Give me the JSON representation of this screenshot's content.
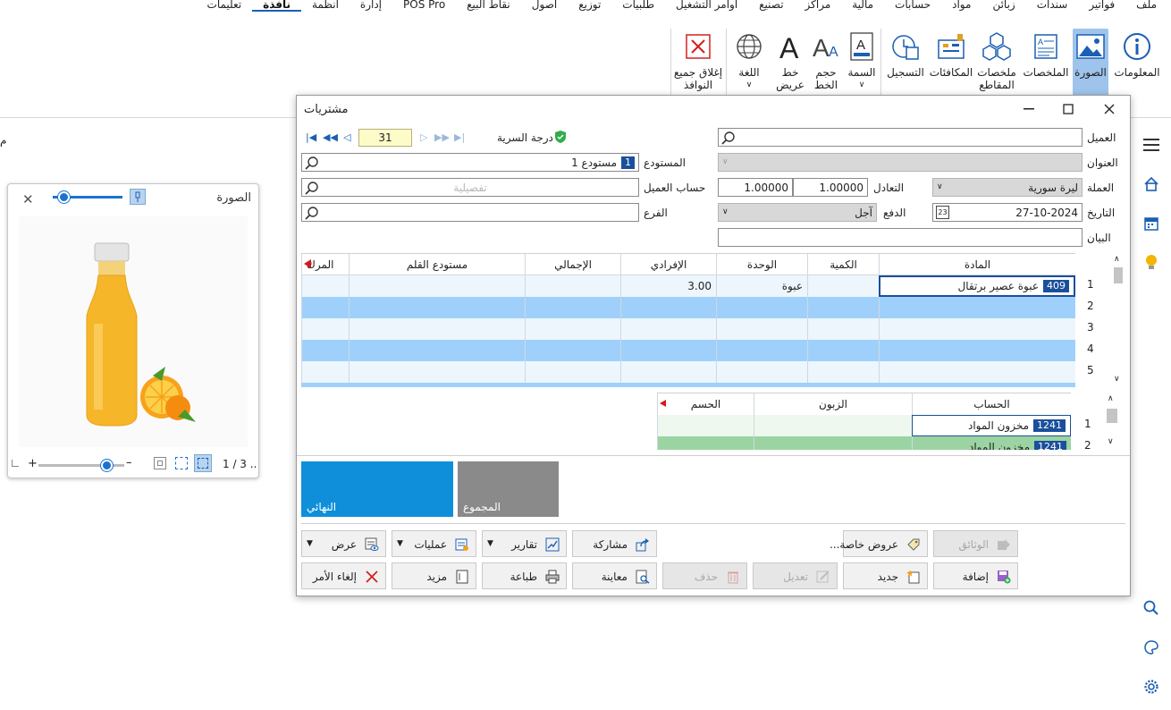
{
  "menu": [
    "ملف",
    "فواتير",
    "سندات",
    "زبائن",
    "مواد",
    "حسابات",
    "مالية",
    "مراكز",
    "تصنيع",
    "أوامر التشغيل",
    "طلبيات",
    "توزيع",
    "أصول",
    "نقاط البيع",
    "POS Pro",
    "إدارة",
    "أنظمة",
    "نافذة",
    "تعليمات"
  ],
  "menu_active": "نافذة",
  "ribbon": {
    "info": "المعلومات",
    "image": "الصورة",
    "summaries": "الملخصات",
    "segment_summaries": "ملخصات\nالمقاطع",
    "rewards": "المكافئات",
    "registration": "التسجيل",
    "theme": "السمة",
    "font_size": "حجم\nالخط",
    "bold_font": "خط\nعريض",
    "language": "اللغة",
    "close_all": "إغلاق جميع\nالنوافذ"
  },
  "image_panel": {
    "title": "الصورة",
    "pager": "1 / 3 .."
  },
  "dialog": {
    "title": "مشتريات",
    "customer_label": "العميل",
    "address_label": "العنوان",
    "currency_label": "العملة",
    "currency_value": "ليرة سورية",
    "exchange_label": "التعادل",
    "exchange_value_1": "1.00000",
    "exchange_value_2": "1.00000",
    "date_label": "التاريخ",
    "date_value": "27-10-2024",
    "payment_label": "الدفع",
    "payment_value": "آجل",
    "statement_label": "البيان",
    "secrecy_label": "درجة السرية",
    "record_number": "31",
    "warehouse_label": "المستودع",
    "warehouse_code": "1",
    "warehouse_value": "مستودع 1",
    "customer_account_label": "حساب العميل",
    "customer_account_placeholder": "تفصيلية",
    "branch_label": "الفرع"
  },
  "items_grid": {
    "headers": [
      "المادة",
      "الكمية",
      "الوحدة",
      "الإفرادي",
      "الإجمالي",
      "مستودع القلم",
      "المرك"
    ],
    "rows": [
      {
        "num": "1",
        "code": "409",
        "item": "عبوة عصير برتقال",
        "qty": "",
        "unit": "عبوة",
        "price": "3.00",
        "total": "",
        "wh": ""
      },
      {
        "num": "2"
      },
      {
        "num": "3"
      },
      {
        "num": "4"
      },
      {
        "num": "5"
      }
    ]
  },
  "accounts_grid": {
    "headers": [
      "الحساب",
      "الزبون",
      "الحسم"
    ],
    "rows": [
      {
        "num": "1",
        "code": "1241",
        "account": "مخزون المواد"
      },
      {
        "num": "2",
        "code": "1241",
        "account": "مخزون المواد"
      }
    ]
  },
  "tiles": {
    "final": "النهائي",
    "total": "المجموع"
  },
  "buttons": {
    "documents": "الوثائق",
    "special_offers": "عروض خاصة...",
    "share": "مشاركة",
    "reports": "تقارير",
    "operations": "عمليات",
    "view": "عرض",
    "add": "إضافة",
    "new": "جديد",
    "edit": "تعديل",
    "delete": "حذف",
    "preview": "معاينة",
    "print": "طباعة",
    "more": "مزيد",
    "cancel": "إلغاء الأمر"
  },
  "colors": {
    "accent": "#1a5fb4",
    "row_blue": "#9fd0fb",
    "row_green": "#9bd4a2",
    "tile_final": "#0f8fd9",
    "tile_total": "#8a8a8a"
  }
}
